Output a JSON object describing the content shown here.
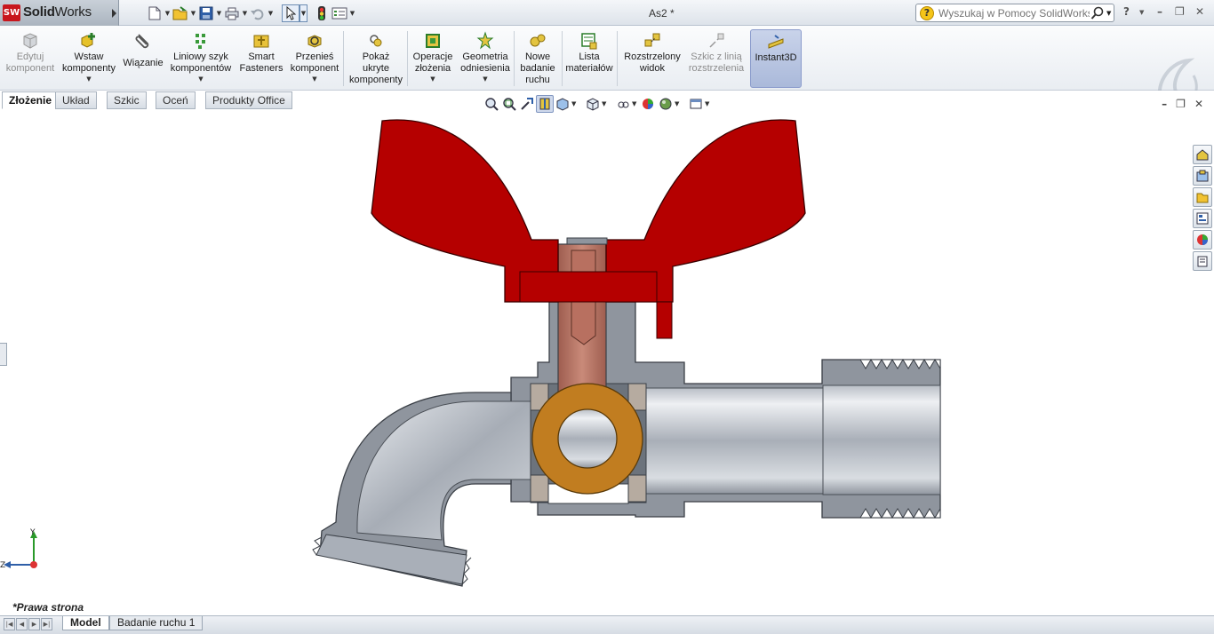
{
  "app": {
    "brand_bold": "Solid",
    "brand_rest": "Works",
    "brand_badge": "SW",
    "document_title": "As2 *"
  },
  "help_search": {
    "placeholder": "Wyszukaj w Pomocy SolidWorks"
  },
  "quick_access": [
    "new-document-icon",
    "open-document-icon",
    "save-icon",
    "print-icon",
    "undo-icon",
    "select-icon",
    "rebuild-icon",
    "options-icon",
    "customize-icon"
  ],
  "commands": [
    {
      "label": "Edytuj\nkomponent",
      "icon": "edit-component-icon",
      "enabled": false,
      "dropdown": false
    },
    {
      "label": "Wstaw\nkomponenty",
      "icon": "insert-components-icon",
      "enabled": true,
      "dropdown": true
    },
    {
      "label": "Wiązanie",
      "icon": "mate-icon",
      "enabled": true,
      "dropdown": false
    },
    {
      "label": "Liniowy szyk\nkomponentów",
      "icon": "linear-pattern-icon",
      "enabled": true,
      "dropdown": true
    },
    {
      "label": "Smart\nFasteners",
      "icon": "smart-fasteners-icon",
      "enabled": true,
      "dropdown": false
    },
    {
      "label": "Przenieś\nkomponent",
      "icon": "move-component-icon",
      "enabled": true,
      "dropdown": true
    },
    {
      "label": "Pokaż\nukryte\nkomponenty",
      "icon": "show-hidden-icon",
      "enabled": true,
      "dropdown": false
    },
    {
      "label": "Operacje\nzłożenia",
      "icon": "assembly-features-icon",
      "enabled": true,
      "dropdown": true
    },
    {
      "label": "Geometria\nodniesienia",
      "icon": "reference-geometry-icon",
      "enabled": true,
      "dropdown": true
    },
    {
      "label": "Nowe\nbadanie\nruchu",
      "icon": "motion-study-icon",
      "enabled": true,
      "dropdown": false
    },
    {
      "label": "Lista\nmateriałów",
      "icon": "bom-icon",
      "enabled": true,
      "dropdown": false
    },
    {
      "label": "Rozstrzelony\nwidok",
      "icon": "exploded-view-icon",
      "enabled": true,
      "dropdown": false
    },
    {
      "label": "Szkic z linią\nrozstrzelenia",
      "icon": "explode-line-sketch-icon",
      "enabled": false,
      "dropdown": false
    },
    {
      "label": "Instant3D",
      "icon": "instant3d-icon",
      "enabled": true,
      "dropdown": false,
      "active": true
    }
  ],
  "tabs": [
    "Złożenie",
    "Układ",
    "Szkic",
    "Oceń",
    "Produkty Office"
  ],
  "active_tab": "Złożenie",
  "hud_tools": [
    "zoom-to-fit-icon",
    "zoom-area-icon",
    "previous-view-icon",
    "section-view-icon",
    "view-orientation-icon",
    "display-style-icon",
    "hide-show-items-icon",
    "edit-appearance-icon",
    "apply-scene-icon",
    "view-settings-icon"
  ],
  "task_pane": [
    "home-icon",
    "design-library-icon",
    "file-explorer-icon",
    "view-palette-icon",
    "appearances-icon",
    "custom-properties-icon"
  ],
  "triad": {
    "y_label": "Y",
    "z_label": "Z"
  },
  "view_name": "*Prawa strona",
  "bottom_tabs": [
    "Model",
    "Badanie ruchu 1"
  ],
  "active_bottom_tab": "Model",
  "colors": {
    "handle_red": "#b50000",
    "ball_orange": "#c17d20",
    "stem_copper": "#b87060",
    "body_gray": "#8f959e",
    "hilite": "#aab9da"
  }
}
